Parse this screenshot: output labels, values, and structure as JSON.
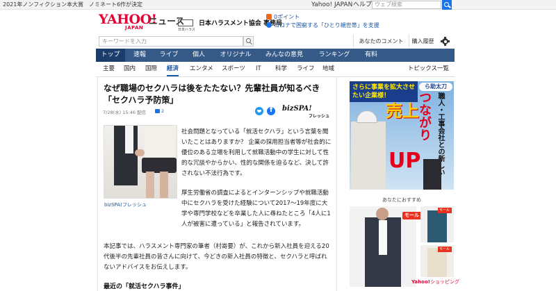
{
  "topbar": {
    "promo_1": "2021年ノンフィクション本大賞",
    "promo_2": "ノミネート6作が決定",
    "yahoo_japan": "Yahoo! JAPAN",
    "help": "ヘルプ",
    "web_search_placeholder": "ウェブ検索"
  },
  "header": {
    "logo_yahoo": "YAHOO!",
    "logo_japan": "JAPAN",
    "logo_news": "ニュース",
    "sponsor_name": "日本ハラスメント協会 事務局",
    "sponsor_logo_text": "日本ハラス",
    "points": "0ポイント",
    "corona_link": "コロナで困窮する「ひとり親世帯」を支援"
  },
  "search": {
    "keyword_placeholder": "キーワードを入力",
    "your_comments": "あなたのコメント",
    "purchase_history": "購入履歴"
  },
  "mainnav": {
    "tabs": [
      "トップ",
      "速報",
      "ライブ",
      "個人",
      "オリジナル",
      "みんなの意見",
      "ランキング",
      "有料"
    ],
    "active": "トップ"
  },
  "subnav": {
    "items": [
      "主要",
      "国内",
      "国際",
      "経済",
      "エンタメ",
      "スポーツ",
      "IT",
      "科学",
      "ライフ",
      "地域"
    ],
    "active": "経済",
    "topics": "トピックス一覧"
  },
  "article": {
    "title": "なぜ職場のセクハラは後をたたない？先輩社員が知るべき「セクハラ予防策」",
    "meta": "7/28(水) 15:46 配信",
    "comment_count": "2",
    "publisher": "bizSPA!",
    "publisher_sub": "フレッシュ",
    "photo_caption": "bizSPA!フレッシュ",
    "paragraph_1": "社会問題となっている「就活セクハラ」という言葉を聞いたことはありますか？ 企業の採用担当者等が社会的に優位のある立場を利用して就職活動中の学生に対して性的な冗談やからかい、性的な関係を迫るなど、決して許されない不法行為です。",
    "paragraph_2": "厚生労働省の調査によるとインターンシップや就職活動中にセクハラを受けた経験について2017〜19年度に大学や専門学校などを卒業した人に尋ねたところ「4人に1人が被害に遭っている」と報告されています。",
    "paragraph_3": "本記事では、ハラスメント専門家の筆者（村嵜要）が、これから新入社員を迎える20代後半の先輩社員の皆さんに向けて、今どきの新入社員の特徴と、セクハラと呼ばれないアドバイスをお伝えします。",
    "section_heading": "最近の「就活セクハラ事件」"
  },
  "ad": {
    "headline": "さらに事業を拡大させたい企業様！",
    "brand": "ら助太刀",
    "vertical_text": "職人・工事会社との新しい",
    "big_text_1": "つながり",
    "big_text_2": "売上",
    "big_text_3": "UP"
  },
  "recommend": {
    "title": "あなたにおすすめ",
    "badge": "モール",
    "shop_yahoo": "Yahoo!",
    "shop_name": "ショッピング"
  },
  "colors": {
    "nav_bg": "#355a88",
    "nav_active": "#1b3d6b",
    "yahoo_red": "#e60033",
    "link_blue": "#1a57a8"
  }
}
